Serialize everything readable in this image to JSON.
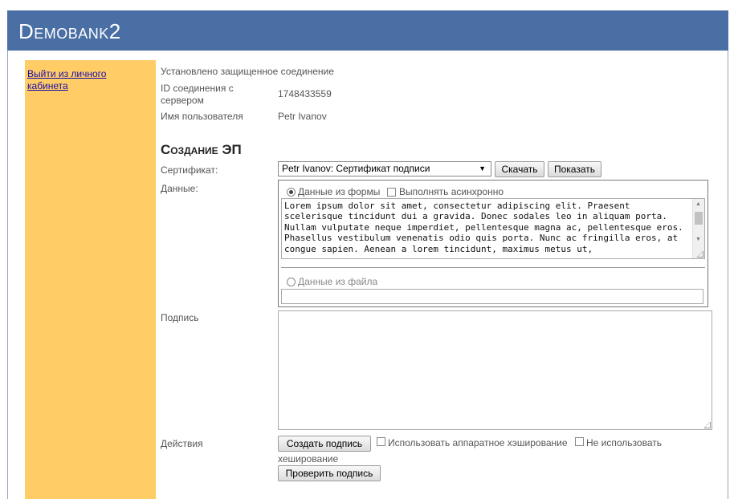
{
  "header": {
    "brand": "Demobank2"
  },
  "sidebar": {
    "logout_link": "Выйти из личного кабинета"
  },
  "connection": {
    "status_text": "Установлено защищенное соединение",
    "id_label": "ID соединения с сервером",
    "id_value": "1748433559",
    "user_label": "Имя пользователя",
    "user_value": "Petr Ivanov"
  },
  "section": {
    "title": "Создание ЭП"
  },
  "certificate": {
    "label": "Сертификат:",
    "selected": "Petr Ivanov: Сертификат подписи",
    "download_button": "Скачать",
    "show_button": "Показать"
  },
  "data": {
    "label": "Данные:",
    "from_form_label": "Данные из формы",
    "async_label": "Выполнять асинхронно",
    "text": "Lorem ipsum dolor sit amet, consectetur adipiscing elit. Praesent scelerisque tincidunt dui a gravida. Donec sodales leo in aliquam porta. Nullam vulputate neque imperdiet, pellentesque magna ac, pellentesque eros. Phasellus vestibulum venenatis odio quis porta. Nunc ac fringilla eros, at congue sapien. Aenean a lorem tincidunt, maximus metus ut,",
    "from_file_label": "Данные из файла",
    "file_value": ""
  },
  "signature": {
    "label": "Подпись",
    "value": ""
  },
  "actions": {
    "label": "Действия",
    "create_button": "Создать подпись",
    "hw_hash_label": "Использовать аппаратное хэширование",
    "no_hash_label": "Не использовать хеширование",
    "verify_button": "Проверить подпись"
  },
  "colors": {
    "header_bg": "#4a6fa5",
    "sidebar_bg": "#ffcc66",
    "link": "#1a0dab"
  }
}
